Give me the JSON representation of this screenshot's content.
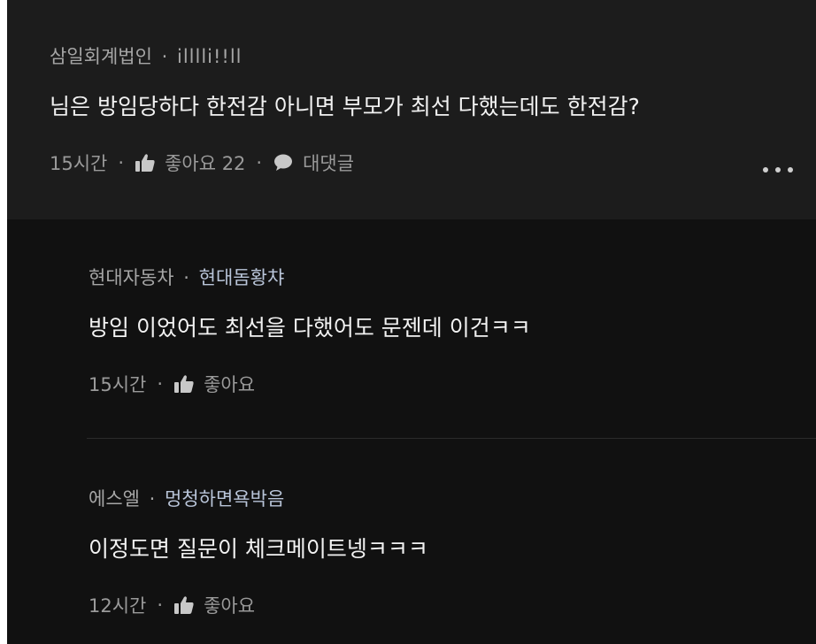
{
  "comments": [
    {
      "author": "삼일회계법인",
      "nickname": "illlli!!ll",
      "text": "님은 방임당하다 한전감 아니면 부모가 최선 다했는데도 한전감?",
      "time": "15시간",
      "like_label": "좋아요 22",
      "reply_label": "대댓글"
    },
    {
      "author": "현대자동차",
      "nickname": "현대돔황챠",
      "text": "방임 이었어도 최선을 다했어도 문젠데 이건ㅋㅋ",
      "time": "15시간",
      "like_label": "좋아요"
    },
    {
      "author": "에스엘",
      "nickname": "멍청하면욕박음",
      "text": "이정도면 질문이 체크메이트넹ㅋㅋㅋ",
      "time": "12시간",
      "like_label": "좋아요"
    }
  ],
  "separator": "·",
  "icons": {
    "like": "thumbs-up-icon",
    "reply": "speech-bubble-icon",
    "more": "more-horizontal-icon"
  },
  "colors": {
    "background": "#111111",
    "highlight": "#1c1c1c",
    "nickname_accent": "#b9c5d9"
  }
}
